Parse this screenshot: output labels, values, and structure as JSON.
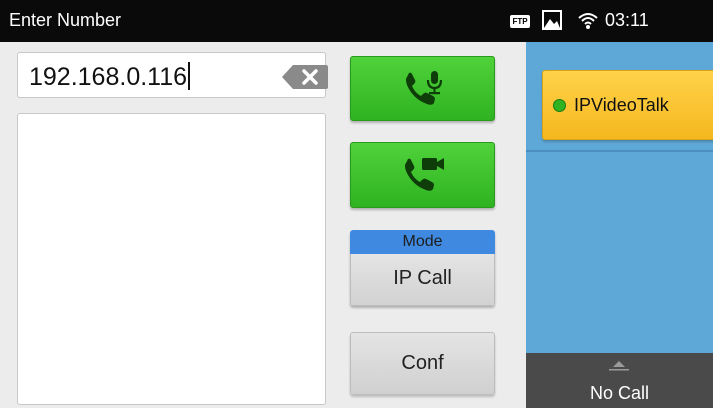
{
  "status_bar": {
    "title": "Enter Number",
    "ftp_badge": "FTP",
    "time": "03:11",
    "icons": [
      "ftp-icon",
      "image-icon",
      "wifi-icon"
    ]
  },
  "dialer": {
    "number_value": "192.168.0.116",
    "backspace_icon": "backspace-icon",
    "audio_call_icon": "phone-mic-icon",
    "video_call_icon": "phone-video-icon",
    "mode_label": "Mode",
    "mode_value": "IP Call",
    "conf_label": "Conf"
  },
  "accounts": {
    "selected_name": "IPVideoTalk",
    "status_color": "#2fb321"
  },
  "call_status": {
    "text": "No Call"
  },
  "colors": {
    "accent_green": "#3cc52b",
    "mode_blue": "#3f8ae0",
    "panel_blue": "#5ea8d8",
    "account_yellow": "#f7c32e"
  }
}
